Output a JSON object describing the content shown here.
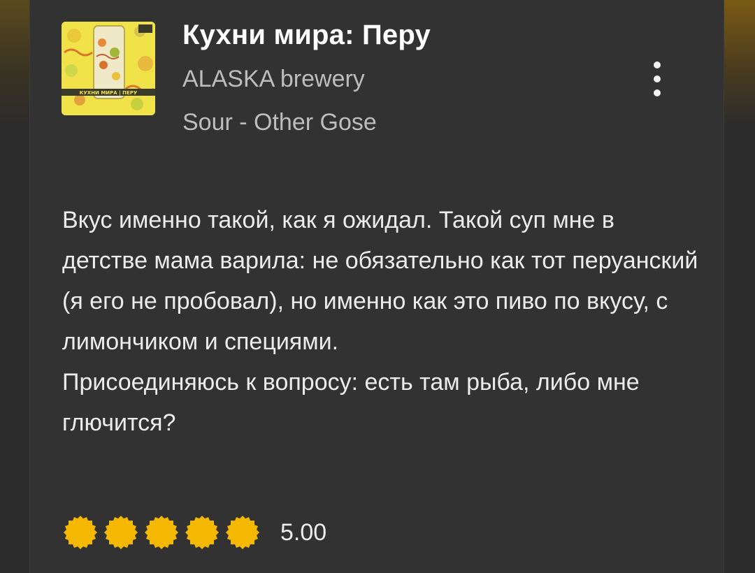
{
  "beer": {
    "name": "Кухни мира: Перу",
    "brewery": "ALASKA brewery",
    "style": "Sour - Other Gose",
    "label_text": "КУХНИ МИРА | ПЕРУ"
  },
  "review": {
    "paragraphs": [
      "Вкус именно такой, как я ожидал. Такой суп мне в детстве мама варила: не обязательно как тот перуанский (я его не пробовал), но именно как это пиво по вкусу, с лимончиком и специями.",
      "Присоединяюсь к вопросу: есть там рыба, либо мне глючится?"
    ]
  },
  "rating": {
    "caps_filled": 5,
    "caps_total": 5,
    "score_text": "5.00"
  },
  "icons": {
    "menu": "more-vert-icon",
    "rating_cap": "bottle-cap-icon"
  },
  "colors": {
    "cap_fill": "#f5b800",
    "label_yellow": "#f2e24a",
    "title_text": "#ffffff",
    "muted_text": "#bdbdbd",
    "background": "#323232"
  }
}
